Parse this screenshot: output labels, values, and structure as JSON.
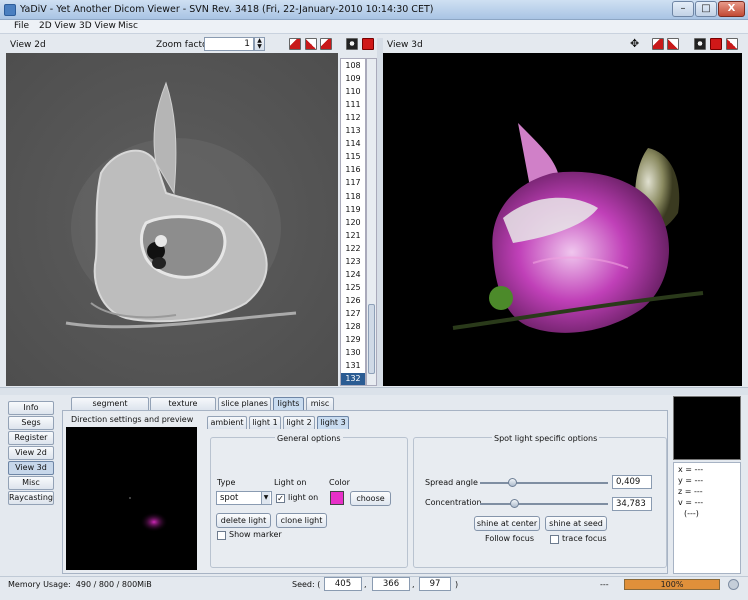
{
  "window": {
    "title": "YaDiV - Yet Another Dicom Viewer - SVN Rev. 3418 (Fri, 22-January-2010 10:14:30 CET)",
    "minimize": "–",
    "maximize": "□",
    "close": "X"
  },
  "menu": [
    "File",
    "2D View",
    "3D View",
    "Misc"
  ],
  "view2d": {
    "label": "View 2d",
    "zoom_label": "Zoom factor",
    "zoom_value": "1",
    "slices": [
      "108",
      "109",
      "110",
      "111",
      "112",
      "113",
      "114",
      "115",
      "116",
      "117",
      "118",
      "119",
      "120",
      "121",
      "122",
      "123",
      "124",
      "125",
      "126",
      "127",
      "128",
      "129",
      "130",
      "131",
      "132"
    ],
    "selected_slice": "132"
  },
  "view3d": {
    "label": "View 3d"
  },
  "sidebar": [
    "Info",
    "Segs",
    "Register",
    "View 2d",
    "View 3d",
    "Misc",
    "Raycasting"
  ],
  "sidebar_active": "View 3d",
  "main_tabs": [
    "segment rendering",
    "texture renderer",
    "slice planes",
    "lights",
    "misc"
  ],
  "main_tab_active": "lights",
  "preview_title": "Direction settings and preview",
  "light_tabs": [
    "ambient",
    "light 1",
    "light 2",
    "light 3"
  ],
  "light_tab_active": "light 3",
  "general": {
    "title": "General options",
    "type_label": "Type",
    "type_value": "spot",
    "light_on_label": "Light on",
    "light_on_checkbox": "light on",
    "color_label": "Color",
    "color_value": "#e830c8",
    "choose": "choose",
    "delete": "delete light",
    "clone": "clone light",
    "show_marker": "Show marker"
  },
  "spot": {
    "title": "Spot light specific options",
    "spread_label": "Spread angle",
    "spread_value": "0,409",
    "conc_label": "Concentration",
    "conc_value": "34,783",
    "shine_center": "shine at center",
    "shine_seed": "shine at seed",
    "follow_focus": "Follow focus",
    "trace_focus": "trace focus"
  },
  "coords": {
    "x": "x = ---",
    "y": "y = ---",
    "z": "z = ---",
    "v": "v = ---",
    "extra": "(---)"
  },
  "status": {
    "memory": "Memory Usage:  490 / 800 / 800MiB",
    "seed_label": "Seed: (",
    "seed_x": "405",
    "seed_y": "366",
    "seed_z": "97",
    "sep1": ",",
    "sep2": ",",
    "close_paren": ")",
    "progress_dash": "---",
    "progress": "100%"
  }
}
